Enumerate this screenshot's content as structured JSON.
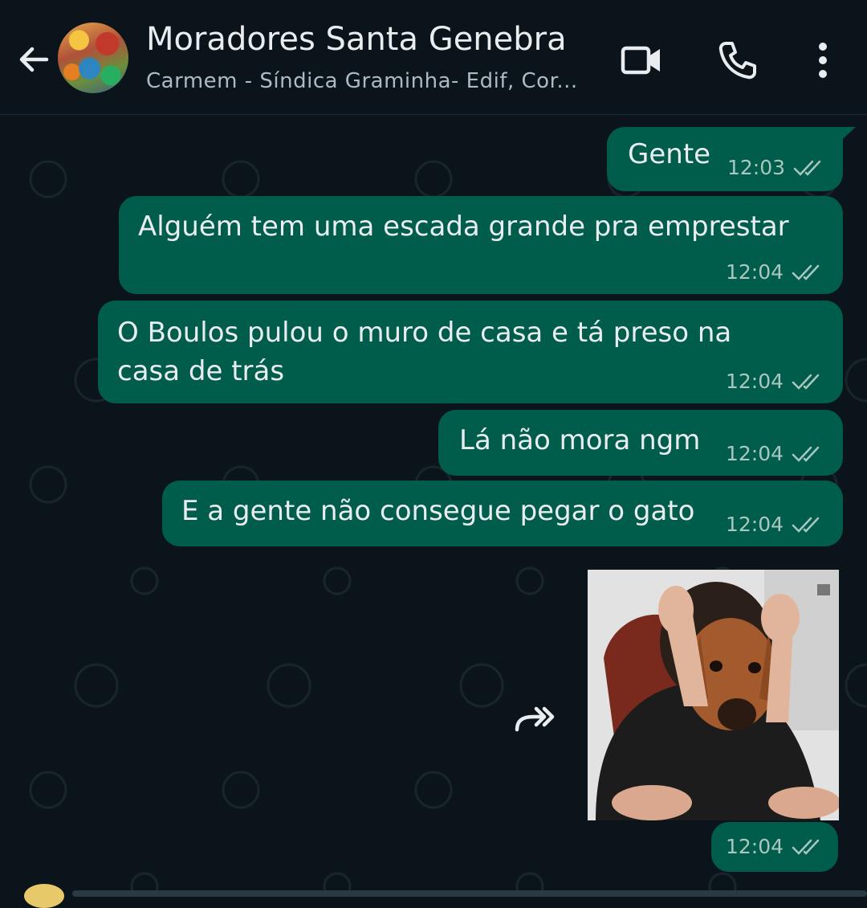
{
  "header": {
    "title": "Moradores Santa Genebra",
    "subtitle": "Carmem - Síndica Graminha- Edif, Cor...",
    "back_icon": "arrow-left-icon",
    "video_icon": "video-call-icon",
    "call_icon": "phone-icon",
    "menu_icon": "more-vertical-icon"
  },
  "messages": [
    {
      "text": "Gente",
      "time": "12:03"
    },
    {
      "text": "Alguém tem uma escada grande pra emprestar",
      "time": "12:04"
    },
    {
      "text_line1": "O Boulos pulou o muro de casa e tá preso na",
      "text_line2": "casa de trás",
      "time": "12:04"
    },
    {
      "text": "Lá não mora ngm",
      "time": "12:04"
    },
    {
      "text": "E a gente não consegue pegar o gato",
      "time": "12:04"
    },
    {
      "image": "dog-head-meme-photo",
      "time": "12:04"
    }
  ],
  "colors": {
    "background": "#0b141a",
    "outgoing_bubble": "#005c4b",
    "text": "#e9edef",
    "meta": "#a9c7bf"
  }
}
